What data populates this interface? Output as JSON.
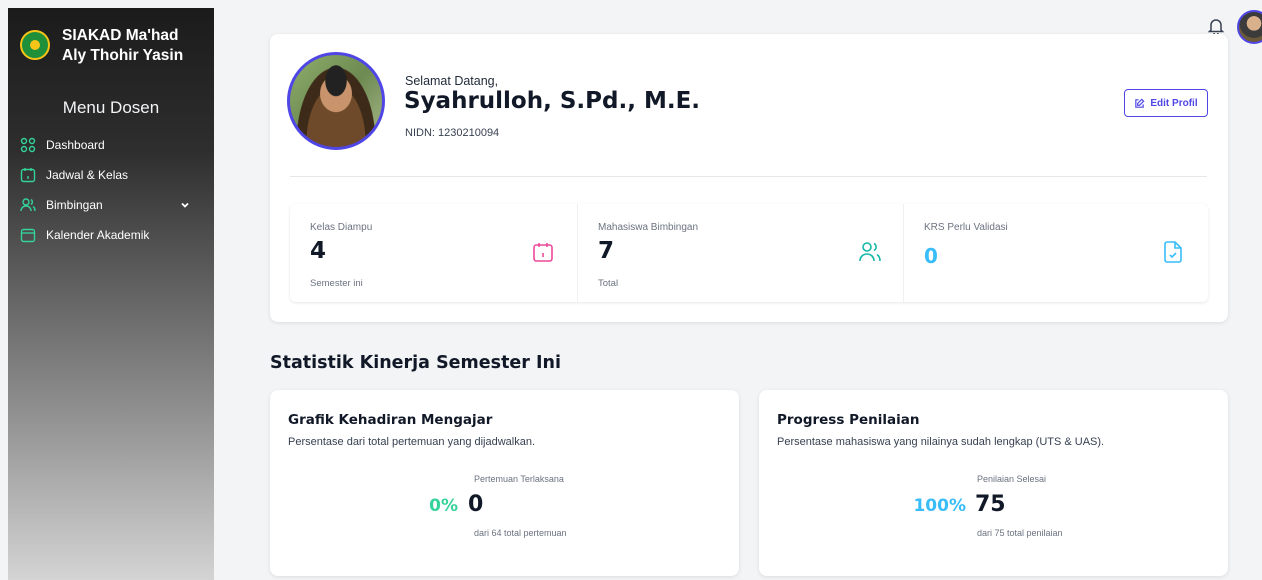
{
  "sidebar": {
    "brand": "SIAKAD Ma'had Aly Thohir Yasin",
    "menu_title": "Menu Dosen",
    "items": [
      {
        "label": "Dashboard",
        "icon": "grid-icon"
      },
      {
        "label": "Jadwal & Kelas",
        "icon": "calendar-icon"
      },
      {
        "label": "Bimbingan",
        "icon": "users-icon",
        "has_submenu": true
      },
      {
        "label": "Kalender Akademik",
        "icon": "calendar-outline-icon"
      }
    ]
  },
  "header": {
    "notification_icon": "bell-icon",
    "avatar_icon": "user-avatar"
  },
  "profile": {
    "welcome": "Selamat Datang,",
    "name": "Syahrulloh, S.Pd., M.E.",
    "nidn": "NIDN: 1230210094",
    "edit_label": "Edit Profil"
  },
  "stats": [
    {
      "label": "Kelas Diampu",
      "value": "4",
      "sub": "Semester ini",
      "color": "#ec4899",
      "icon": "calendar-icon"
    },
    {
      "label": "Mahasiswa Bimbingan",
      "value": "7",
      "sub": "Total",
      "color": "#14b8a6",
      "icon": "users-icon"
    },
    {
      "label": "KRS Perlu Validasi",
      "value": "0",
      "sub": "",
      "color": "#38bdf8",
      "icon": "file-check-icon"
    }
  ],
  "section_title": "Statistik Kinerja Semester Ini",
  "performance": [
    {
      "title": "Grafik Kehadiran Mengajar",
      "desc": "Persentase dari total pertemuan yang dijadwalkan.",
      "label": "Pertemuan Terlaksana",
      "percent": "0%",
      "value": "0",
      "sub": "dari 64 total pertemuan",
      "color": "#34d399"
    },
    {
      "title": "Progress Penilaian",
      "desc": "Persentase mahasiswa yang nilainya sudah lengkap (UTS & UAS).",
      "label": "Penilaian Selesai",
      "percent": "100%",
      "value": "75",
      "sub": "dari 75 total penilaian",
      "color": "#38bdf8"
    }
  ],
  "colors": {
    "accent": "#4f46e5"
  }
}
